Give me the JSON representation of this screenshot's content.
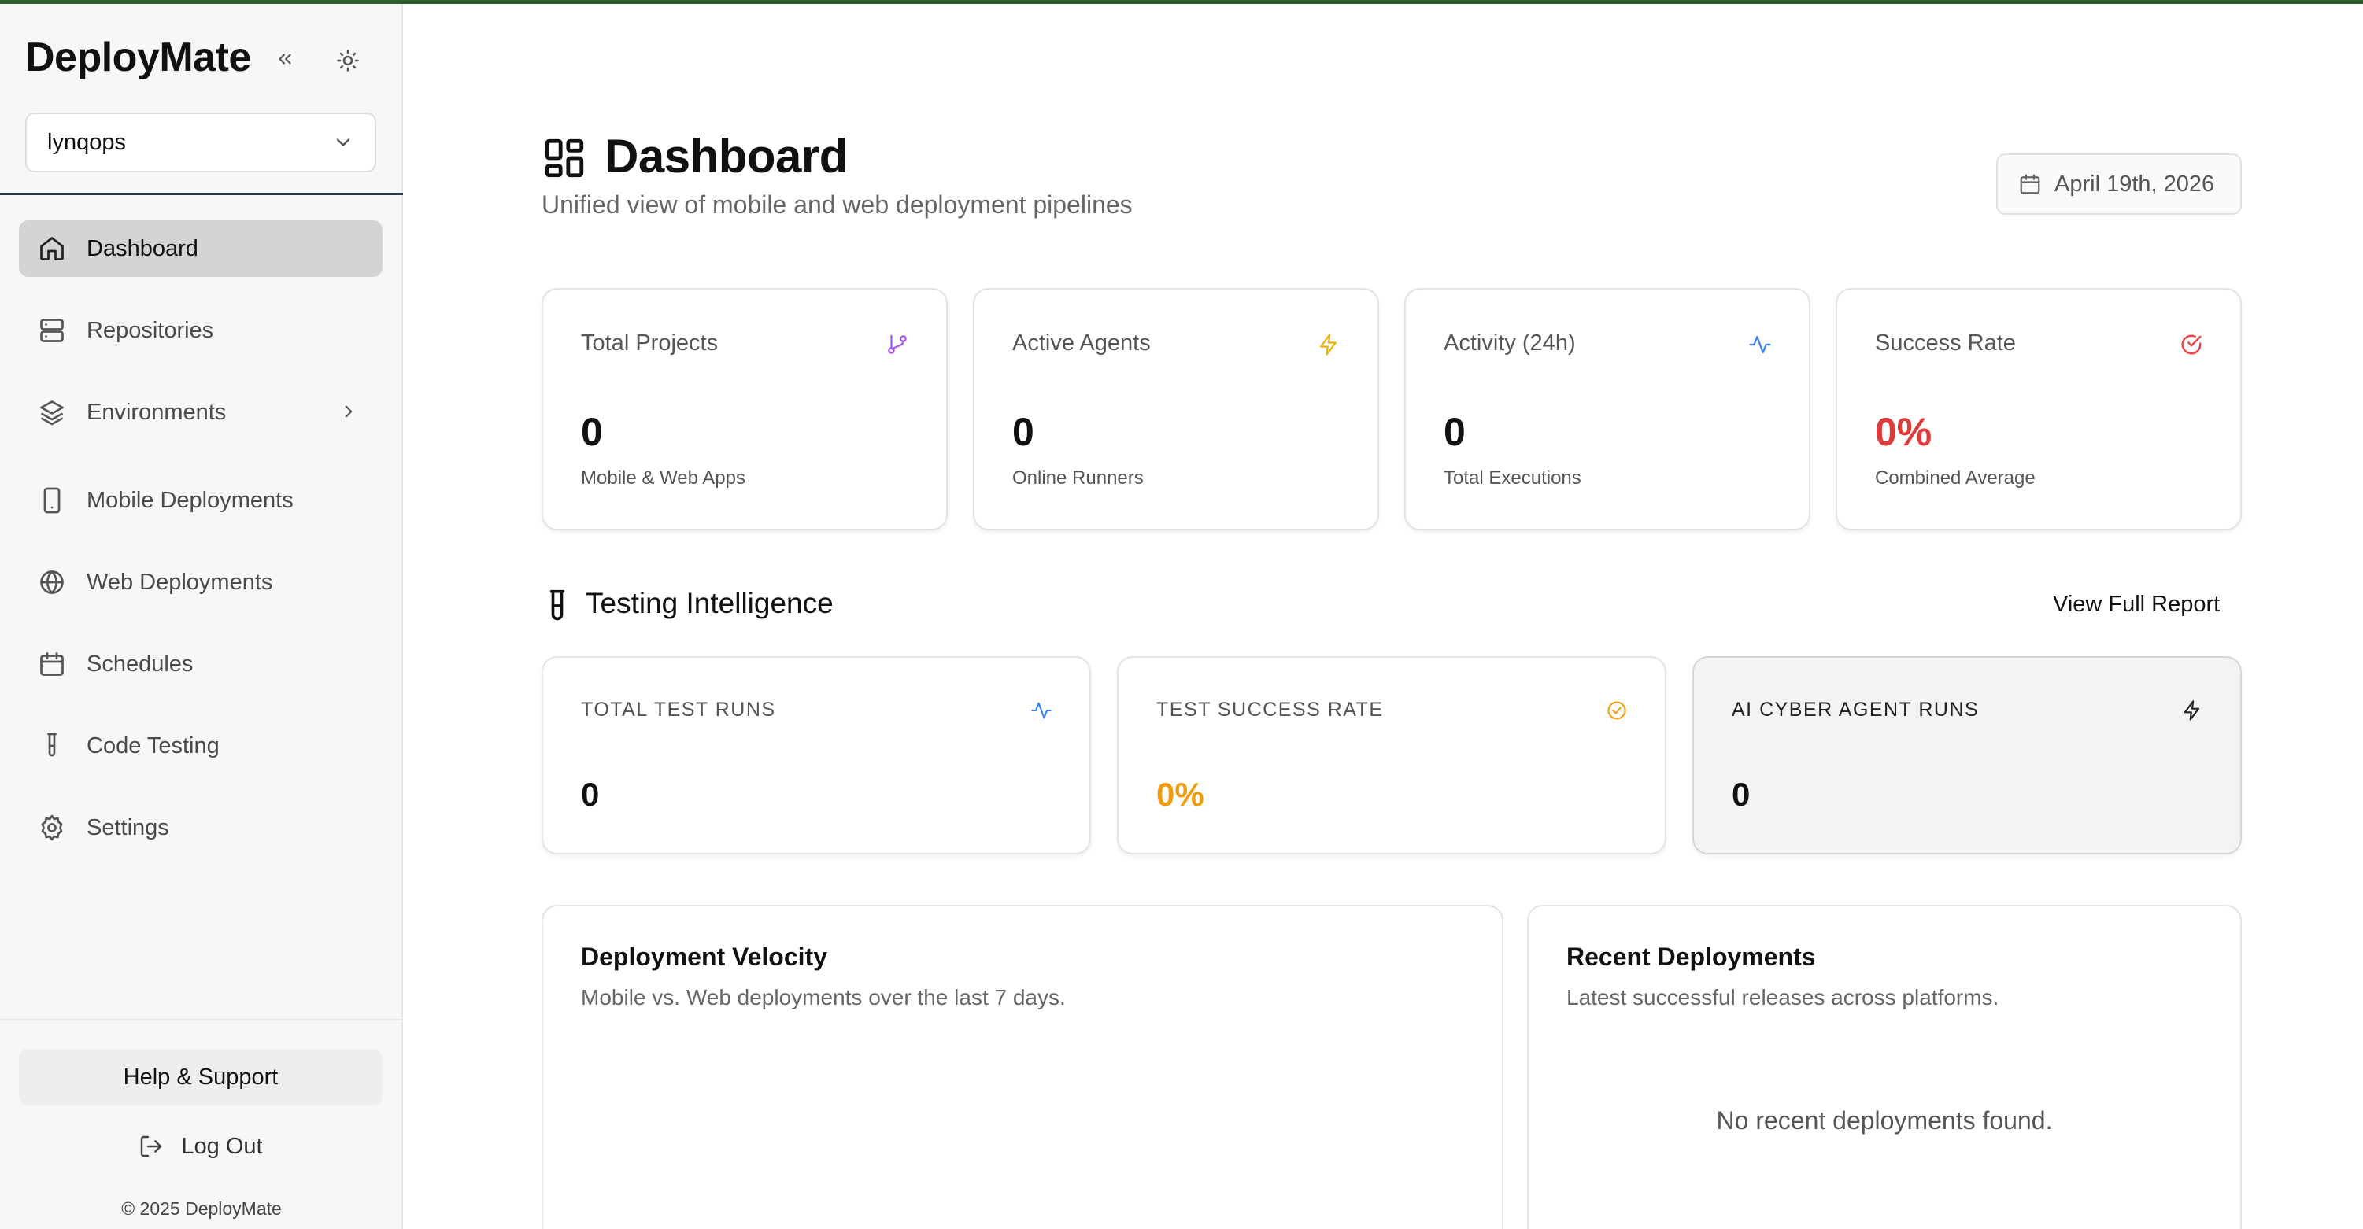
{
  "app": {
    "brand": "DeployMate",
    "org": "lynqops",
    "copyright": "© 2025 DeployMate"
  },
  "sidebar": {
    "items": [
      {
        "label": "Dashboard",
        "icon": "home-icon",
        "active": true
      },
      {
        "label": "Repositories",
        "icon": "server-icon"
      },
      {
        "label": "Environments",
        "icon": "layers-icon",
        "has_submenu": true
      },
      {
        "label": "Mobile Deployments",
        "icon": "smartphone-icon"
      },
      {
        "label": "Web Deployments",
        "icon": "globe-icon"
      },
      {
        "label": "Schedules",
        "icon": "calendar-icon"
      },
      {
        "label": "Code Testing",
        "icon": "test-tube-icon"
      },
      {
        "label": "Settings",
        "icon": "gear-icon"
      }
    ],
    "help_label": "Help & Support",
    "logout_label": "Log Out"
  },
  "header": {
    "title": "Dashboard",
    "subtitle": "Unified view of mobile and web deployment pipelines",
    "date": "April 19th, 2026"
  },
  "stats": [
    {
      "label": "Total Projects",
      "value": "0",
      "sub": "Mobile & Web Apps",
      "icon": "git-branch-icon",
      "icon_color": "#a855f7",
      "value_color": "#111111"
    },
    {
      "label": "Active Agents",
      "value": "0",
      "sub": "Online Runners",
      "icon": "zap-icon",
      "icon_color": "#eab308",
      "value_color": "#111111"
    },
    {
      "label": "Activity (24h)",
      "value": "0",
      "sub": "Total Executions",
      "icon": "activity-icon",
      "icon_color": "#3b82f6",
      "value_color": "#111111"
    },
    {
      "label": "Success Rate",
      "value": "0%",
      "sub": "Combined Average",
      "icon": "check-circle-icon",
      "icon_color": "#ef4444",
      "value_color": "#e03a3a"
    }
  ],
  "testing": {
    "title": "Testing Intelligence",
    "view_report": "View Full Report",
    "cards": [
      {
        "label": "TOTAL TEST RUNS",
        "value": "0",
        "icon": "activity-icon",
        "icon_color": "#3b82f6",
        "value_color": "#111111"
      },
      {
        "label": "TEST SUCCESS RATE",
        "value": "0%",
        "icon": "check-circle-icon",
        "icon_color": "#f59e0b",
        "value_color": "#f29a0a"
      },
      {
        "label": "AI CYBER AGENT RUNS",
        "value": "0",
        "icon": "zap-icon",
        "icon_color": "#222222",
        "value_color": "#111111"
      }
    ]
  },
  "velocity": {
    "title": "Deployment Velocity",
    "subtitle": "Mobile vs. Web deployments over the last 7 days."
  },
  "recent": {
    "title": "Recent Deployments",
    "subtitle": "Latest successful releases across platforms.",
    "empty": "No recent deployments found."
  }
}
